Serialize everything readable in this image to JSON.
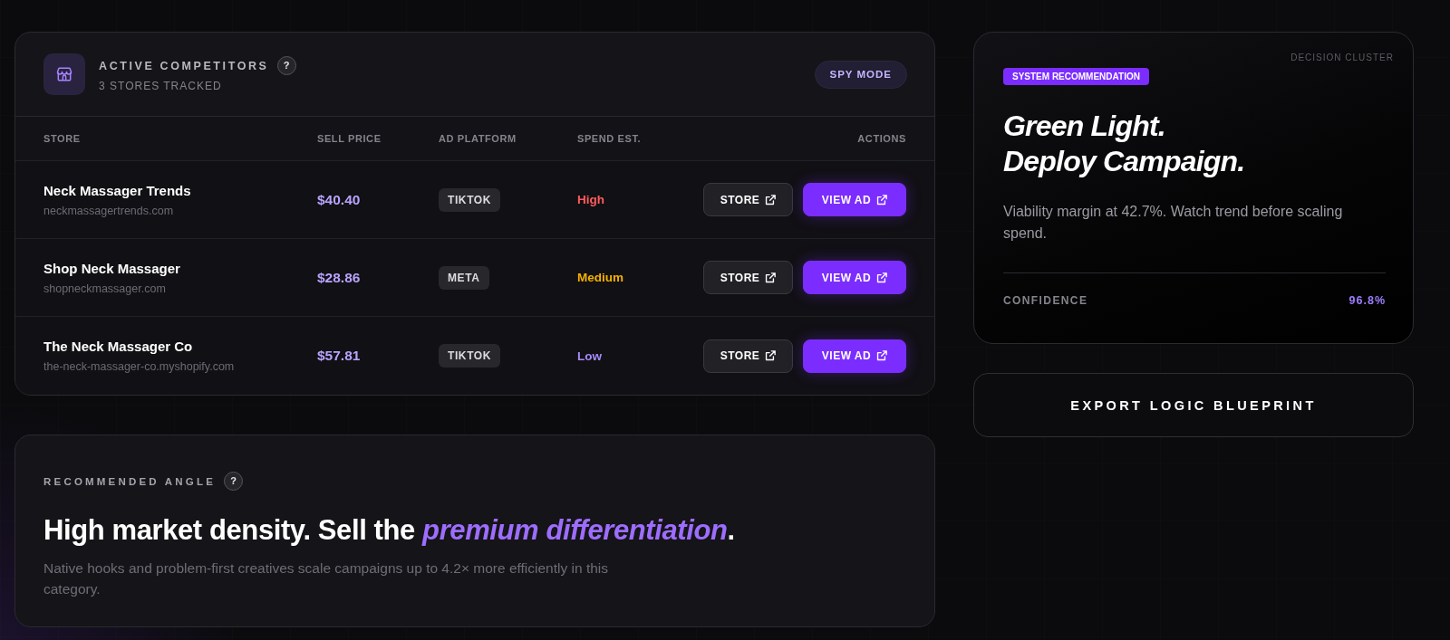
{
  "competitors": {
    "title": "ACTIVE COMPETITORS",
    "help": "?",
    "subtitle": "3 STORES TRACKED",
    "mode_button": "SPY MODE",
    "columns": [
      "STORE",
      "SELL PRICE",
      "AD PLATFORM",
      "SPEND EST.",
      "ACTIONS"
    ],
    "rows": [
      {
        "store": "Neck Massager Trends",
        "domain": "neckmassagertrends.com",
        "price": "$40.40",
        "platform": "TIKTOK",
        "spend": {
          "text": "High",
          "color": "#ff5c5c"
        },
        "actions": [
          {
            "label": "STORE",
            "kind": "secondary"
          },
          {
            "label": "VIEW AD",
            "kind": "primary"
          }
        ]
      },
      {
        "store": "Shop Neck Massager",
        "domain": "shopneckmassager.com",
        "price": "$28.86",
        "platform": "META",
        "spend": {
          "text": "Medium",
          "color": "#f5b000"
        },
        "actions": [
          {
            "label": "STORE",
            "kind": "secondary"
          },
          {
            "label": "VIEW AD",
            "kind": "primary"
          }
        ]
      },
      {
        "store": "The Neck Massager Co",
        "domain": "the-neck-massager-co.myshopify.com",
        "price": "$57.81",
        "platform": "TIKTOK",
        "spend": {
          "text": "Low",
          "color": "#a78bfa"
        },
        "actions": [
          {
            "label": "STORE",
            "kind": "secondary"
          },
          {
            "label": "VIEW AD",
            "kind": "primary"
          }
        ]
      }
    ]
  },
  "angle": {
    "label": "RECOMMENDED ANGLE",
    "help": "?",
    "headline": "High market density. Sell the *premium differentiation*.",
    "description": "Native hooks and problem-first creatives scale campaigns up to 4.2× more efficiently in this category."
  },
  "recommendation": {
    "cluster_label": "DECISION CLUSTER",
    "badge": "SYSTEM RECOMMENDATION",
    "headline": [
      "Green Light.",
      "Deploy Campaign."
    ],
    "summary": "Viability margin at 42.7%. Watch trend before scaling spend.",
    "metric": {
      "label": "CONFIDENCE",
      "value": "96.8%"
    }
  },
  "export_button": "EXPORT LOGIC BLUEPRINT"
}
